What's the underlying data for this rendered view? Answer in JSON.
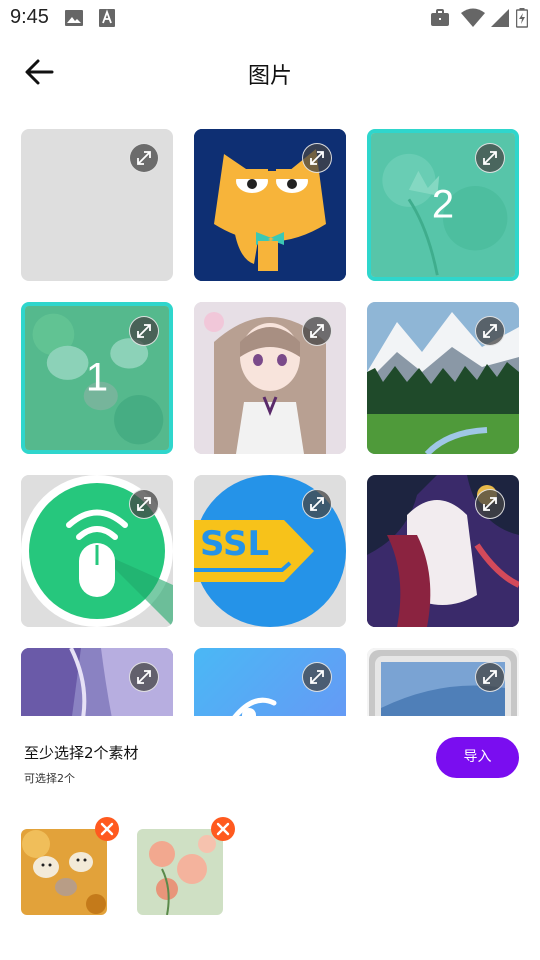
{
  "status_bar": {
    "time": "9:45"
  },
  "header": {
    "title": "图片"
  },
  "grid": {
    "tiles": [
      {
        "row": 1,
        "col": 1,
        "selected": false,
        "selection_number": ""
      },
      {
        "row": 1,
        "col": 2,
        "selected": false,
        "selection_number": ""
      },
      {
        "row": 1,
        "col": 3,
        "selected": true,
        "selection_number": "2"
      },
      {
        "row": 2,
        "col": 1,
        "selected": true,
        "selection_number": "1"
      },
      {
        "row": 2,
        "col": 2,
        "selected": false,
        "selection_number": ""
      },
      {
        "row": 2,
        "col": 3,
        "selected": false,
        "selection_number": ""
      },
      {
        "row": 3,
        "col": 1,
        "selected": false,
        "selection_number": ""
      },
      {
        "row": 3,
        "col": 2,
        "selected": false,
        "selection_number": ""
      },
      {
        "row": 3,
        "col": 3,
        "selected": false,
        "selection_number": ""
      },
      {
        "row": 4,
        "col": 1,
        "selected": false,
        "selection_number": ""
      },
      {
        "row": 4,
        "col": 2,
        "selected": false,
        "selection_number": ""
      },
      {
        "row": 4,
        "col": 3,
        "selected": false,
        "selection_number": ""
      }
    ],
    "selection_color": "#2fd6cc"
  },
  "bottom": {
    "hint": "至少选择2个素材",
    "sub_hint": "可选择2个",
    "import_label": "导入",
    "import_color": "#7a0df0",
    "remove_color": "#ff5a1f"
  }
}
